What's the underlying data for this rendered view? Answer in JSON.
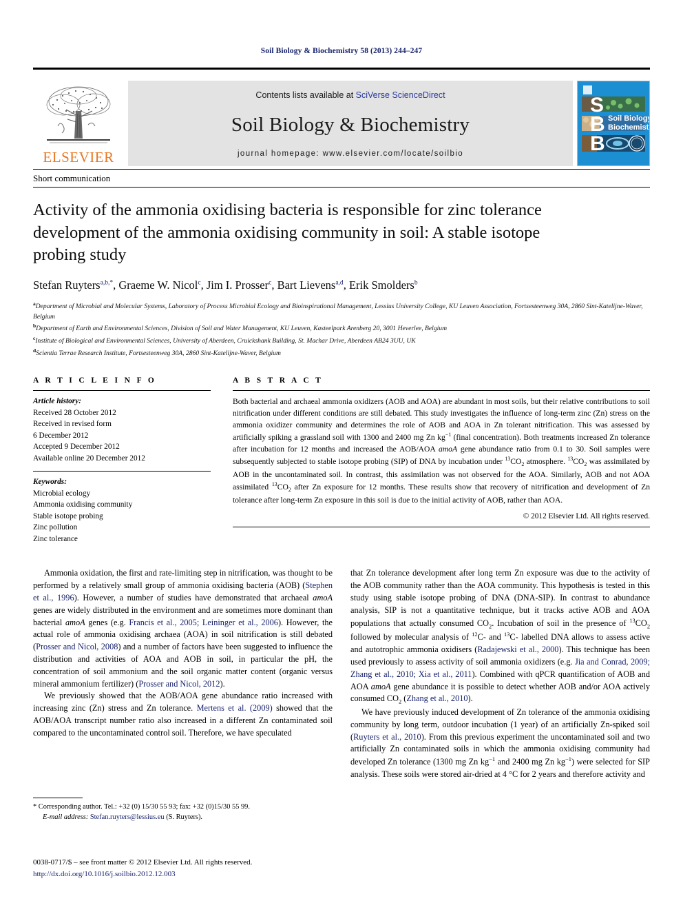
{
  "running_head": "Soil Biology & Biochemistry 58 (2013) 244–247",
  "masthead": {
    "publisher_name": "ELSEVIER",
    "contents_prefix": "Contents lists available at ",
    "contents_link": "SciVerse ScienceDirect",
    "journal_title": "Soil Biology & Biochemistry",
    "homepage": "journal homepage: www.elsevier.com/locate/soilbio",
    "cover_title_line1": "Soil Biology &",
    "cover_title_line2": "Biochemistry",
    "cover_letters": [
      "S",
      "B",
      "B"
    ],
    "cover_bg_color": "#1b8fd1",
    "accent_orange": "#e87722",
    "link_blue": "#17226b"
  },
  "article_type": "Short communication",
  "title": "Activity of the ammonia oxidising bacteria is responsible for zinc tolerance development of the ammonia oxidising community in soil: A stable isotope probing study",
  "authors": [
    {
      "name": "Stefan Ruyters",
      "sup": "a,b,*"
    },
    {
      "name": "Graeme W. Nicol",
      "sup": "c"
    },
    {
      "name": "Jim I. Prosser",
      "sup": "c"
    },
    {
      "name": "Bart Lievens",
      "sup": "a,d"
    },
    {
      "name": "Erik Smolders",
      "sup": "b"
    }
  ],
  "affiliations": [
    {
      "marker": "a",
      "text": "Department of Microbial and Molecular Systems, Laboratory of Process Microbial Ecology and Bioinspirational Management, Lessius University College, KU Leuven Association, Fortsesteenweg 30A, 2860 Sint-Katelijne-Waver, Belgium"
    },
    {
      "marker": "b",
      "text": "Department of Earth and Environmental Sciences, Division of Soil and Water Management, KU Leuven, Kasteelpark Arenberg 20, 3001 Heverlee, Belgium"
    },
    {
      "marker": "c",
      "text": "Institute of Biological and Environmental Sciences, University of Aberdeen, Cruickshank Building, St. Machar Drive, Aberdeen AB24 3UU, UK"
    },
    {
      "marker": "d",
      "text": "Scientia Terrae Research Institute, Fortsesteenweg 30A, 2860 Sint-Katelijne-Waver, Belgium"
    }
  ],
  "article_info": {
    "heading": "A R T I C L E   I N F O",
    "history_label": "Article history:",
    "history": [
      "Received 28 October 2012",
      "Received in revised form",
      "6 December 2012",
      "Accepted 9 December 2012",
      "Available online 20 December 2012"
    ],
    "keywords_label": "Keywords:",
    "keywords": [
      "Microbial ecology",
      "Ammonia oxidising community",
      "Stable isotope probing",
      "Zinc pollution",
      "Zinc tolerance"
    ]
  },
  "abstract": {
    "heading": "A B S T R A C T",
    "paragraph_parts": [
      {
        "t": "Both bacterial and archaeal ammonia oxidizers (AOB and AOA) are abundant in most soils, but their relative contributions to soil nitrification under different conditions are still debated. This study investigates the influence of long-term zinc (Zn) stress on the ammonia oxidizer community and determines the role of AOB and AOA in Zn tolerant nitrification. This was assessed by artificially spiking a grassland soil with 1300 and 2400 mg Zn kg"
      },
      {
        "sup": "−1"
      },
      {
        "t": " (final concentration). Both treatments increased Zn tolerance after incubation for 12 months and increased the AOB/AOA "
      },
      {
        "em": "amoA"
      },
      {
        "t": " gene abundance ratio from 0.1 to 30. Soil samples were subsequently subjected to stable isotope probing (SIP) of DNA by incubation under "
      },
      {
        "sup": "13"
      },
      {
        "t": "CO"
      },
      {
        "sub": "2"
      },
      {
        "t": " atmosphere. "
      },
      {
        "sup": "13"
      },
      {
        "t": "CO"
      },
      {
        "sub": "2"
      },
      {
        "t": " was assimilated by AOB in the uncontaminated soil. In contrast, this assimilation was not observed for the AOA. Similarly, AOB and not AOA assimilated "
      },
      {
        "sup": "13"
      },
      {
        "t": "CO"
      },
      {
        "sub": "2"
      },
      {
        "t": " after Zn exposure for 12 months. These results show that recovery of nitrification and development of Zn tolerance after long-term Zn exposure in this soil is due to the initial activity of AOB, rather than AOA."
      }
    ],
    "copyright": "© 2012 Elsevier Ltd. All rights reserved."
  },
  "body": {
    "left_column_parts": [
      {
        "p": true
      },
      {
        "t": "Ammonia oxidation, the first and rate-limiting step in nitrification, was thought to be performed by a relatively small group of ammonia oxidising bacteria (AOB) ("
      },
      {
        "ref": "Stephen et al., 1996"
      },
      {
        "t": "). However, a number of studies have demonstrated that archaeal "
      },
      {
        "em": "amoA"
      },
      {
        "t": " genes are widely distributed in the environment and are sometimes more dominant than bacterial "
      },
      {
        "em": "amoA"
      },
      {
        "t": " genes (e.g. "
      },
      {
        "ref": "Francis et al., 2005; Leininger et al., 2006"
      },
      {
        "t": "). However, the actual role of ammonia oxidising archaea (AOA) in soil nitrification is still debated ("
      },
      {
        "ref": "Prosser and Nicol, 2008"
      },
      {
        "t": ") and a number of factors have been suggested to influence the distribution and activities of AOA and AOB in soil, in particular the pH, the concentration of soil ammonium and the soil organic matter content (organic versus mineral ammonium fertilizer) ("
      },
      {
        "ref": "Prosser and Nicol, 2012"
      },
      {
        "t": ")."
      },
      {
        "p": true
      },
      {
        "t": "We previously showed that the AOB/AOA gene abundance ratio increased with increasing zinc (Zn) stress and Zn tolerance. "
      },
      {
        "ref": "Mertens et al. (2009)"
      },
      {
        "t": " showed that the AOB/AOA transcript number ratio also increased in a different Zn contaminated soil compared to the uncontaminated control soil. Therefore, we have speculated"
      }
    ],
    "right_column_parts": [
      {
        "t": "that Zn tolerance development after long term Zn exposure was due to the activity of the AOB community rather than the AOA community. This hypothesis is tested in this study using stable isotope probing of DNA (DNA-SIP). In contrast to abundance analysis, SIP is not a quantitative technique, but it tracks active AOB and AOA populations that actually consumed CO"
      },
      {
        "sub": "2"
      },
      {
        "t": ". Incubation of soil in the presence of "
      },
      {
        "sup": "13"
      },
      {
        "t": "CO"
      },
      {
        "sub": "2"
      },
      {
        "t": " followed by molecular analysis of "
      },
      {
        "sup": "12"
      },
      {
        "t": "C- and "
      },
      {
        "sup": "13"
      },
      {
        "t": "C- labelled DNA allows to assess active and autotrophic ammonia oxidisers ("
      },
      {
        "ref": "Radajewski et al., 2000"
      },
      {
        "t": "). This technique has been used previously to assess activity of soil ammonia oxidizers (e.g. "
      },
      {
        "ref": "Jia and Conrad, 2009; Zhang et al., 2010; Xia et al., 2011"
      },
      {
        "t": "). Combined with qPCR quantification of AOB and AOA "
      },
      {
        "em": "amoA"
      },
      {
        "t": " gene abundance it is possible to detect whether AOB and/or AOA actively consumed CO"
      },
      {
        "sub": "2"
      },
      {
        "t": " ("
      },
      {
        "ref": "Zhang et al., 2010"
      },
      {
        "t": ")."
      },
      {
        "p": true
      },
      {
        "t": "We have previously induced development of Zn tolerance of the ammonia oxidising community by long term, outdoor incubation (1 year) of an artificially Zn-spiked soil ("
      },
      {
        "ref": "Ruyters et al., 2010"
      },
      {
        "t": "). From this previous experiment the uncontaminated soil and two artificially Zn contaminated soils in which the ammonia oxidising community had developed Zn tolerance (1300 mg Zn kg"
      },
      {
        "sup": "−1"
      },
      {
        "t": " and 2400 mg Zn kg"
      },
      {
        "sup": "−1"
      },
      {
        "t": ") were selected for SIP analysis. These soils were stored air-dried at 4 °C for 2 years and therefore activity and"
      }
    ]
  },
  "footnote": {
    "corresponding": "* Corresponding author. Tel.: +32 (0) 15/30 55 93; fax: +32 (0)15/30 55 99.",
    "email_label": "E-mail address:",
    "email": "Stefan.ruyters@lessius.eu",
    "email_suffix": "(S. Ruyters)."
  },
  "footer": {
    "issn_line": "0038-0717/$ – see front matter © 2012 Elsevier Ltd. All rights reserved.",
    "doi": "http://dx.doi.org/10.1016/j.soilbio.2012.12.003"
  }
}
